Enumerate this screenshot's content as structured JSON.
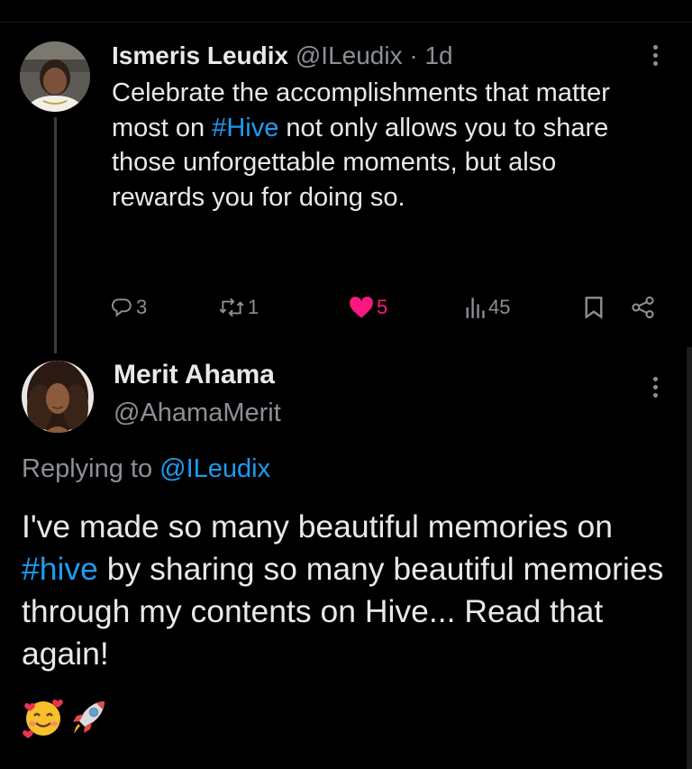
{
  "tweet1": {
    "author_name": "Ismeris Leudix",
    "author_handle": "@ILeudix",
    "separator": "·",
    "time": "1d",
    "text_part1": "Celebrate the accomplishments that matter most on ",
    "hashtag": "#Hive",
    "text_part2": " not only allows you to share those unforgettable moments, but also rewards you for doing so.",
    "stats": {
      "replies": "3",
      "retweets": "1",
      "likes": "5",
      "views": "45"
    }
  },
  "tweet2": {
    "author_name": "Merit Ahama",
    "author_handle": "@AhamaMerit",
    "replying_prefix": "Replying to ",
    "replying_to": "@ILeudix",
    "text_part1": "I've made so many beautiful memories on ",
    "hashtag": "#hive",
    "text_part2": " by sharing so many beautiful memories through my contents on Hive... Read that again!",
    "emojis": [
      "smiling-face-with-hearts",
      "rocket"
    ]
  },
  "colors": {
    "background": "#000000",
    "text": "#e7e9ea",
    "secondary": "#8b9096",
    "link": "#1d9bf0",
    "like": "#f91880"
  },
  "icons": [
    "reply-icon",
    "retweet-icon",
    "heart-icon",
    "views-icon",
    "bookmark-icon",
    "share-icon",
    "more-icon"
  ]
}
